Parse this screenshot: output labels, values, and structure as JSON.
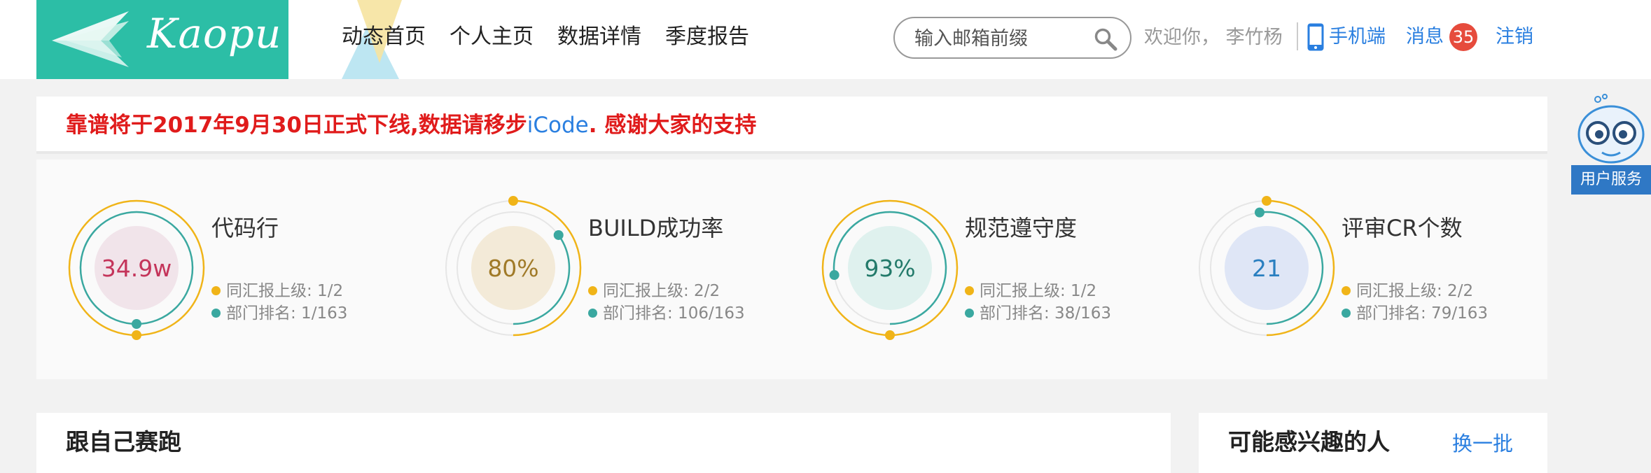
{
  "header": {
    "logo_text": "Kaopu",
    "nav": [
      {
        "label": "动态首页"
      },
      {
        "label": "个人主页"
      },
      {
        "label": "数据详情"
      },
      {
        "label": "季度报告"
      }
    ],
    "search": {
      "placeholder": "输入邮箱前缀",
      "icon": "search-icon"
    },
    "welcome": "欢迎你， 李竹杨",
    "mobile_label": "手机端",
    "message_label": "消息",
    "message_count": "35",
    "logout_label": "注销"
  },
  "notice": {
    "text_before": "靠谱将于2017年9月30日正式下线,数据请移步",
    "link_text": "iCode",
    "text_after": ". 感谢大家的支持"
  },
  "stats": [
    {
      "value": "34.9w",
      "title": "代码行",
      "line1": "同汇报上级: 1/2",
      "line2": "部门排名: 1/163",
      "value_color": "#c4345a",
      "inner_fill": "#f1e4ea",
      "inner_ring": "#3aa8a0",
      "outer_ring": "#f0b418",
      "inner_fraction": 1.0,
      "outer_fraction": 1.0
    },
    {
      "value": "80%",
      "title": "BUILD成功率",
      "line1": "同汇报上级: 2/2",
      "line2": "部门排名: 106/163",
      "value_color": "#a07a28",
      "inner_fill": "#f3ead8",
      "inner_ring": "#3aa8a0",
      "outer_ring": "#f0b418",
      "inner_fraction": 0.35,
      "outer_fraction": 0.5
    },
    {
      "value": "93%",
      "title": "规范遵守度",
      "line1": "同汇报上级: 1/2",
      "line2": "部门排名: 38/163",
      "value_color": "#237a6a",
      "inner_fill": "#dff1ee",
      "inner_ring": "#3aa8a0",
      "outer_ring": "#f0b418",
      "inner_fraction": 0.77,
      "outer_fraction": 1.0
    },
    {
      "value": "21",
      "title": "评审CR个数",
      "line1": "同汇报上级: 2/2",
      "line2": "部门排名: 79/163",
      "value_color": "#2a7fc0",
      "inner_fill": "#dfe6f6",
      "inner_ring": "#3aa8a0",
      "outer_ring": "#f0b418",
      "inner_fraction": 0.52,
      "outer_fraction": 0.5
    }
  ],
  "legend_colors": {
    "superior": "#f0b418",
    "department": "#3aa8a0"
  },
  "race": {
    "title": "跟自己赛跑"
  },
  "people": {
    "title": "可能感兴趣的人",
    "refresh": "换一批"
  },
  "service": {
    "label": "用户服务",
    "icon": "robot-icon"
  }
}
